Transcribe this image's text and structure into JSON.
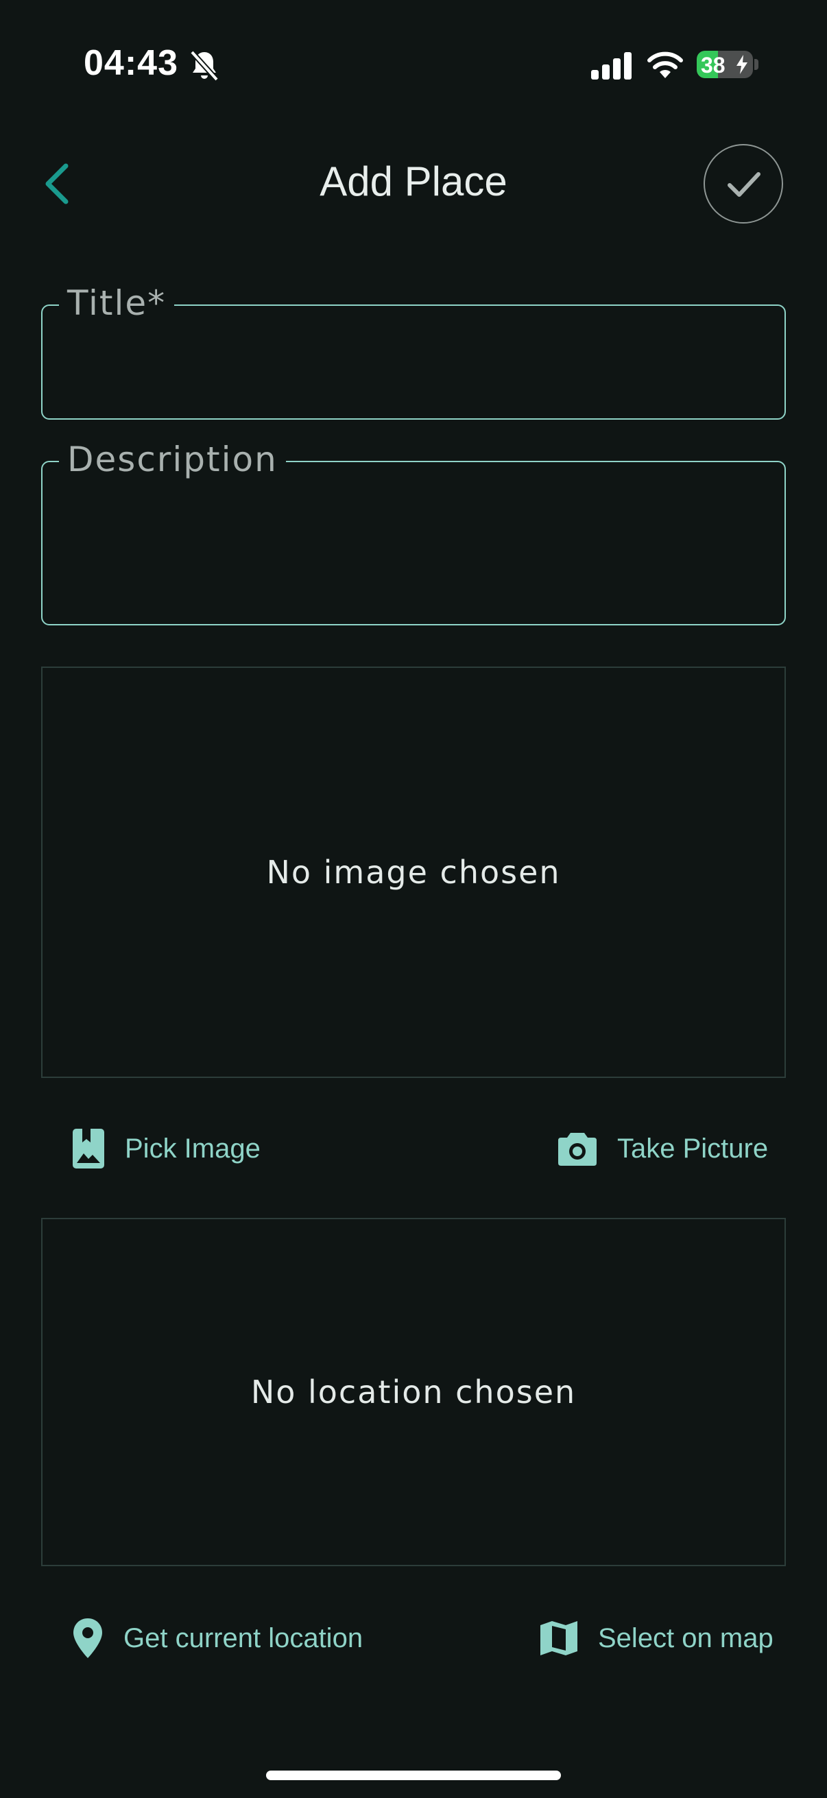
{
  "status_bar": {
    "time": "04:43",
    "battery_level": "38",
    "battery_fraction": 0.38,
    "icons": [
      "bell-slash-icon",
      "cellular-signal-icon",
      "wifi-icon",
      "battery-charging-icon"
    ]
  },
  "app_bar": {
    "title": "Add Place",
    "back_icon": "chevron-left-icon",
    "save_icon": "checkmark-icon"
  },
  "form": {
    "title_field": {
      "label": "Title*",
      "value": ""
    },
    "description_field": {
      "label": "Description",
      "value": ""
    }
  },
  "image_section": {
    "placeholder": "No image chosen",
    "pick_image": {
      "label": "Pick Image",
      "icon": "image-bookmark-icon"
    },
    "take_picture": {
      "label": "Take Picture",
      "icon": "camera-icon"
    }
  },
  "location_section": {
    "placeholder": "No location chosen",
    "current_location": {
      "label": "Get current location",
      "icon": "location-pin-icon"
    },
    "select_on_map": {
      "label": "Select on map",
      "icon": "map-icon"
    }
  },
  "colors": {
    "background": "#0f1514",
    "accent": "#8fd4c8",
    "back_arrow": "#1a9a8e",
    "preview_border": "#2c3d3a",
    "battery_green": "#34c759"
  }
}
